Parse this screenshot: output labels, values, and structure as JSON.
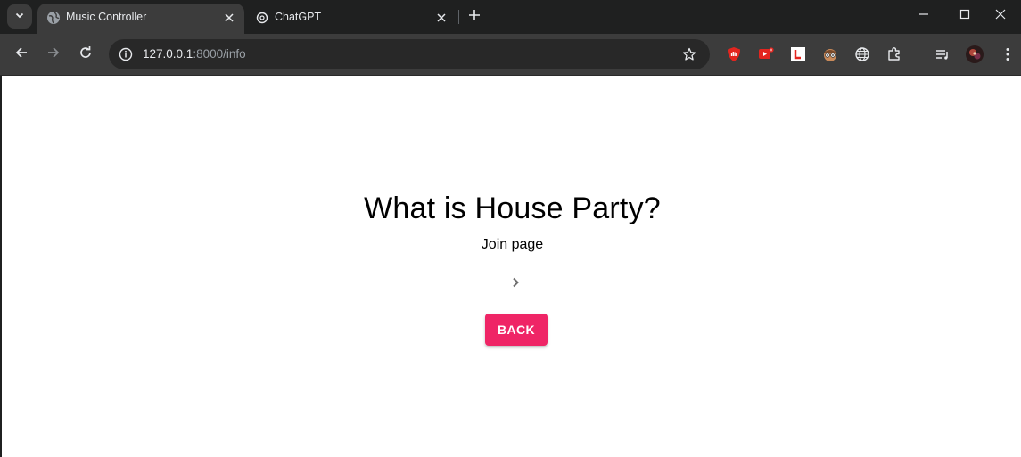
{
  "browser": {
    "tabs": [
      {
        "title": "Music Controller",
        "active": true
      },
      {
        "title": "ChatGPT",
        "active": false
      }
    ],
    "url_host": "127.0.0.1",
    "url_path": ":8000/info"
  },
  "page": {
    "heading": "What is House Party?",
    "subtext": "Join page",
    "back_label": "BACK",
    "accent_color": "#ef2566"
  },
  "icons": {
    "tab_search": "chevron-down-icon",
    "favicon_active": "globe-icon",
    "favicon_inactive": "chatgpt-icon",
    "extensions": [
      "ublock-icon",
      "youtube-extension-icon",
      "l-extension-icon",
      "face-extension-icon",
      "globe-extension-icon",
      "puzzle-icon"
    ],
    "reading_list": "media-queue-icon",
    "profile": "avatar"
  }
}
